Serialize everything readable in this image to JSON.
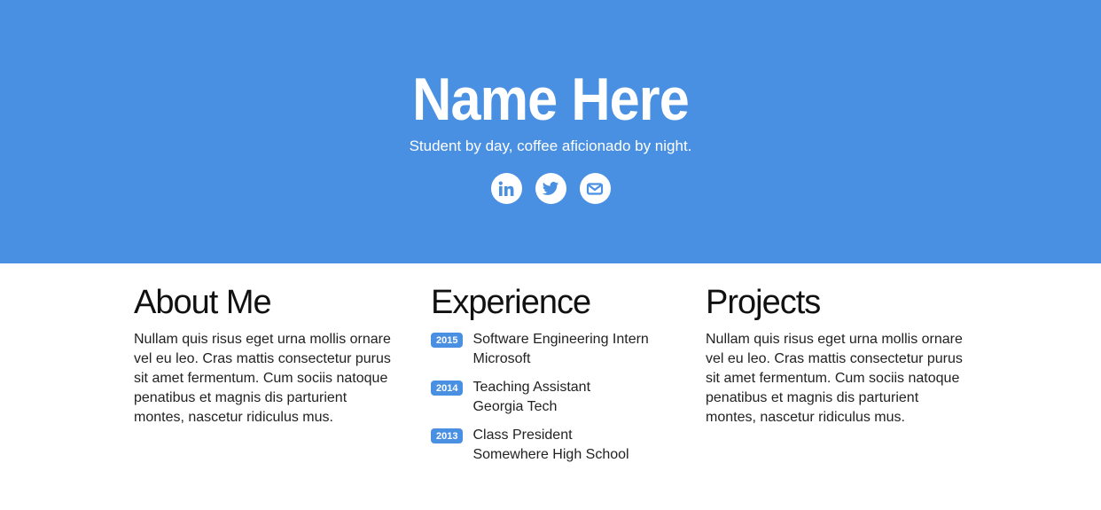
{
  "hero": {
    "name": "Name Here",
    "tagline": "Student by day, coffee aficionado by night.",
    "background_color": "#4a90e2",
    "socials": [
      {
        "icon": "linkedin-icon",
        "label": "LinkedIn"
      },
      {
        "icon": "twitter-icon",
        "label": "Twitter"
      },
      {
        "icon": "envelope-icon",
        "label": "Email"
      }
    ]
  },
  "about": {
    "heading": "About Me",
    "body": "Nullam quis risus eget urna mollis ornare vel eu leo. Cras mattis consectetur purus sit amet fermentum. Cum sociis natoque penatibus et magnis dis parturient montes, nascetur ridiculus mus."
  },
  "experience": {
    "heading": "Experience",
    "items": [
      {
        "year": "2015",
        "title": "Software Engineering Intern",
        "org": "Microsoft"
      },
      {
        "year": "2014",
        "title": "Teaching Assistant",
        "org": "Georgia Tech"
      },
      {
        "year": "2013",
        "title": "Class President",
        "org": "Somewhere High School"
      }
    ]
  },
  "projects": {
    "heading": "Projects",
    "body": "Nullam quis risus eget urna mollis ornare vel eu leo. Cras mattis consectetur purus sit amet fermentum. Cum sociis natoque penatibus et magnis dis parturient montes, nascetur ridiculus mus."
  }
}
